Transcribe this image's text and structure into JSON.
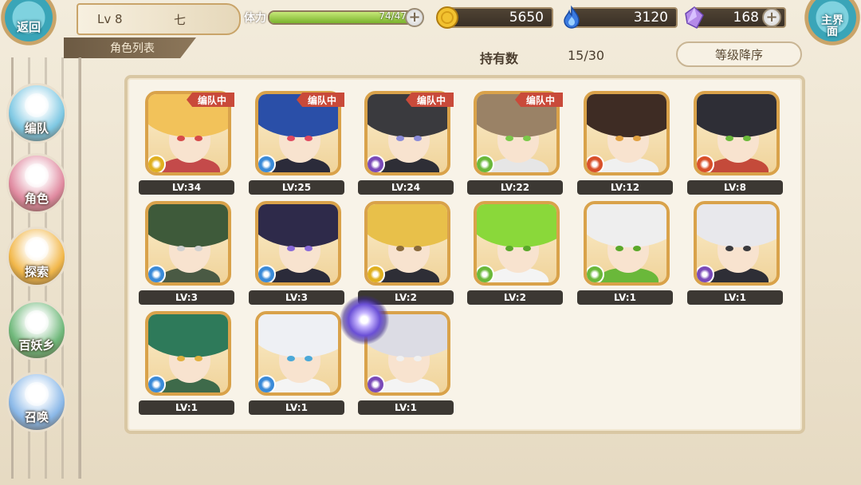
{
  "header": {
    "back_label": "返回",
    "home_label": "主界面",
    "level": "Lv 8",
    "player_name": "七",
    "tab_label": "角色列表",
    "stamina_label": "体力",
    "stamina_value": "74/47",
    "stamina_fraction": 1.0,
    "gold": "5650",
    "soul": "3120",
    "gem": "168",
    "plus": "+"
  },
  "sort": {
    "hold_label": "持有数",
    "hold_count": "15/30",
    "sort_button": "等级降序"
  },
  "nav": {
    "items": [
      {
        "label": "编队",
        "color": "#7ec8e3"
      },
      {
        "label": "角色",
        "color": "#e08aa0"
      },
      {
        "label": "探索",
        "color": "#f2b84b"
      },
      {
        "label": "百妖乡",
        "color": "#6fb87a"
      },
      {
        "label": "召唤",
        "color": "#8ab8e8"
      }
    ]
  },
  "characters": [
    {
      "level": "LV:34",
      "badge": "编队中",
      "hair": "#f2c25a",
      "eyes": "#d64a4a",
      "element": "#e0b020",
      "body": "#c44a4a"
    },
    {
      "level": "LV:25",
      "badge": "编队中",
      "hair": "#2a4fa8",
      "eyes": "#e04a60",
      "element": "#3a8ad8",
      "body": "#2b2b3a"
    },
    {
      "level": "LV:24",
      "badge": "编队中",
      "hair": "#3a3a3e",
      "eyes": "#8a8ad8",
      "element": "#7a4ab8",
      "body": "#2e2e36"
    },
    {
      "level": "LV:22",
      "badge": "编队中",
      "hair": "#9a8266",
      "eyes": "#7ac84a",
      "element": "#6ab83a",
      "body": "#e6e6e6"
    },
    {
      "level": "LV:12",
      "badge": "",
      "hair": "#3e2c24",
      "eyes": "#e0a040",
      "element": "#d8502a",
      "body": "#f0f0f0"
    },
    {
      "level": "LV:8",
      "badge": "",
      "hair": "#2e2e36",
      "eyes": "#6ab83a",
      "element": "#d8502a",
      "body": "#c44a3a"
    },
    {
      "level": "LV:3",
      "badge": "",
      "hair": "#3e5a3a",
      "eyes": "#d0d0d0",
      "element": "#3a8ad8",
      "body": "#4a5a44"
    },
    {
      "level": "LV:3",
      "badge": "",
      "hair": "#2e2a4a",
      "eyes": "#8a6ad8",
      "element": "#3a8ad8",
      "body": "#2b2b3a"
    },
    {
      "level": "LV:2",
      "badge": "",
      "hair": "#e8c04a",
      "eyes": "#8a6a3a",
      "element": "#e0b020",
      "body": "#2e2e36"
    },
    {
      "level": "LV:2",
      "badge": "",
      "hair": "#8ad83a",
      "eyes": "#5aa82a",
      "element": "#6ab83a",
      "body": "#f4f4f4"
    },
    {
      "level": "LV:1",
      "badge": "",
      "hair": "#eeeeee",
      "eyes": "#5aa82a",
      "element": "#6ab83a",
      "body": "#6ab83a"
    },
    {
      "level": "LV:1",
      "badge": "",
      "hair": "#e8e8ec",
      "eyes": "#3a3a3e",
      "element": "#7a4ab8",
      "body": "#2e2e36"
    },
    {
      "level": "LV:1",
      "badge": "",
      "hair": "#2e7a5a",
      "eyes": "#e0b040",
      "element": "#3a8ad8",
      "body": "#3e6a4a"
    },
    {
      "level": "LV:1",
      "badge": "",
      "hair": "#eef0f4",
      "eyes": "#4aa8d8",
      "element": "#3a8ad8",
      "body": "#f4f4f4"
    },
    {
      "level": "LV:1",
      "badge": "",
      "hair": "#dcdce4",
      "eyes": "#f0f0f0",
      "element": "#7a4ab8",
      "body": "#f4f4f4"
    }
  ]
}
